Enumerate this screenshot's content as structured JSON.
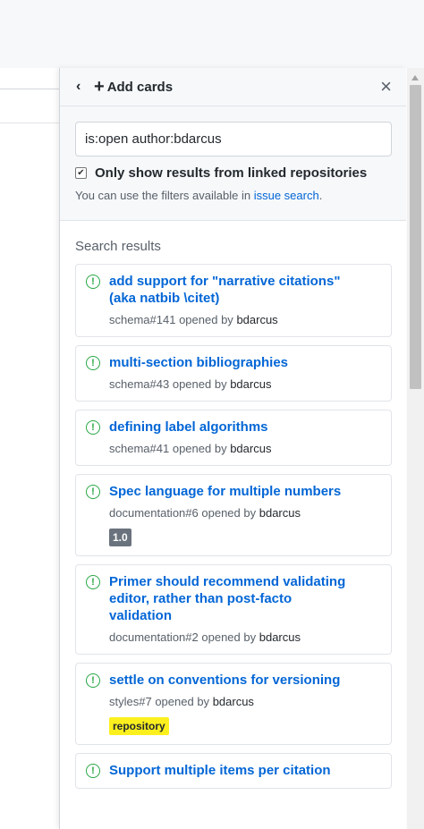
{
  "panel": {
    "back_icon": "chevron-left-icon",
    "title": "Add cards",
    "close_icon": "x-icon"
  },
  "filter": {
    "search_value": "is:open author:bdarcus",
    "checkbox_label": "Only show results from linked repositories",
    "checkbox_checked": true,
    "hint_text": "You can use the filters available in ",
    "hint_link": "issue search",
    "hint_end": "."
  },
  "results": {
    "title": "Search results",
    "opened_by": "opened by",
    "items": [
      {
        "title": "add support for \"narrative citations\" (aka natbib \\citet)",
        "ref": "schema#141",
        "author": "bdarcus"
      },
      {
        "title": "multi-section bibliographies",
        "ref": "schema#43",
        "author": "bdarcus"
      },
      {
        "title": "defining label algorithms",
        "ref": "schema#41",
        "author": "bdarcus"
      },
      {
        "title": "Spec language for multiple numbers",
        "ref": "documentation#6",
        "author": "bdarcus",
        "label": "1.0",
        "label_bg": "#6a737d",
        "label_fg": "#ffffff"
      },
      {
        "title": "Primer should recommend validating editor, rather than post-facto validation",
        "ref": "documentation#2",
        "author": "bdarcus"
      },
      {
        "title": "settle on conventions for versioning",
        "ref": "styles#7",
        "author": "bdarcus",
        "label": "repository",
        "label_bg": "#fbf01e",
        "label_fg": "#24292e"
      },
      {
        "title": "Support multiple items per citation",
        "ref": "",
        "author": ""
      }
    ]
  },
  "colors": {
    "link": "#0366d6",
    "open_issue": "#28a745"
  }
}
